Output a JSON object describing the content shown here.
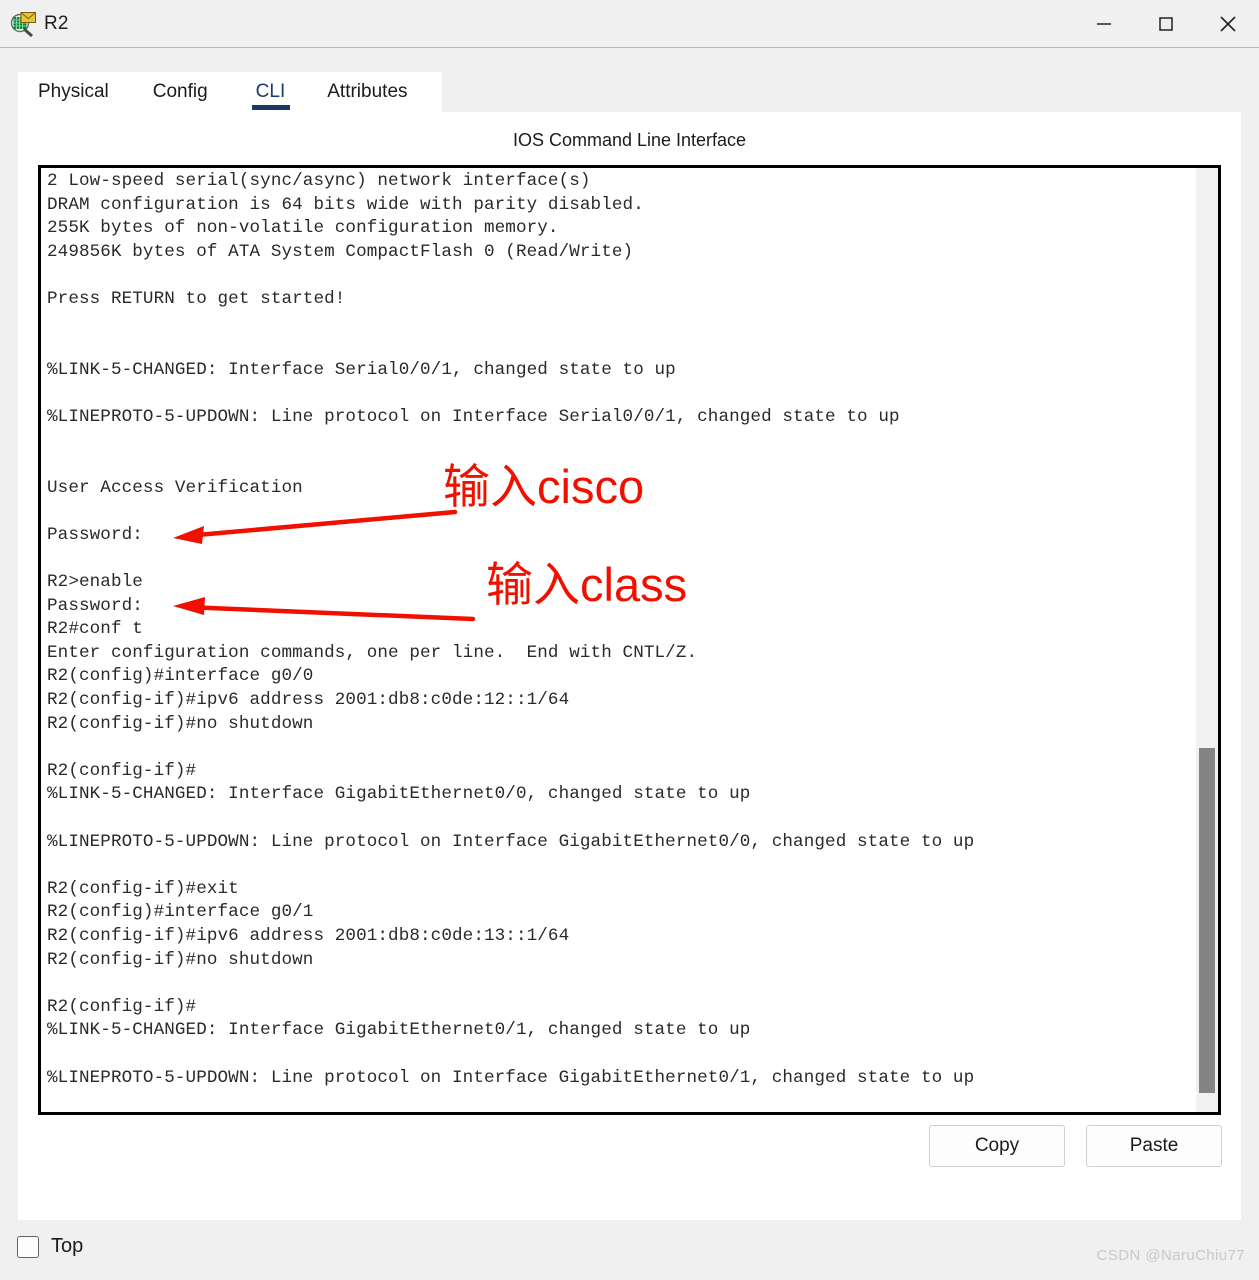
{
  "window": {
    "title": "R2",
    "icon": "inspect-magnifier-icon",
    "controls": {
      "minimize": "minimize-icon",
      "maximize": "maximize-icon",
      "close": "close-icon"
    }
  },
  "tabs": [
    {
      "label": "Physical",
      "active": false
    },
    {
      "label": "Config",
      "active": false
    },
    {
      "label": "CLI",
      "active": true
    },
    {
      "label": "Attributes",
      "active": false
    }
  ],
  "panel": {
    "title": "IOS Command Line Interface"
  },
  "terminal": {
    "lines": [
      "2 Low-speed serial(sync/async) network interface(s)",
      "DRAM configuration is 64 bits wide with parity disabled.",
      "255K bytes of non-volatile configuration memory.",
      "249856K bytes of ATA System CompactFlash 0 (Read/Write)",
      "",
      "Press RETURN to get started!",
      "",
      "",
      "%LINK-5-CHANGED: Interface Serial0/0/1, changed state to up",
      "",
      "%LINEPROTO-5-UPDOWN: Line protocol on Interface Serial0/0/1, changed state to up",
      "",
      "",
      "User Access Verification",
      "",
      "Password:",
      "",
      "R2>enable",
      "Password:",
      "R2#conf t",
      "Enter configuration commands, one per line.  End with CNTL/Z.",
      "R2(config)#interface g0/0",
      "R2(config-if)#ipv6 address 2001:db8:c0de:12::1/64",
      "R2(config-if)#no shutdown",
      "",
      "R2(config-if)#",
      "%LINK-5-CHANGED: Interface GigabitEthernet0/0, changed state to up",
      "",
      "%LINEPROTO-5-UPDOWN: Line protocol on Interface GigabitEthernet0/0, changed state to up",
      "",
      "R2(config-if)#exit",
      "R2(config)#interface g0/1",
      "R2(config-if)#ipv6 address 2001:db8:c0de:13::1/64",
      "R2(config-if)#no shutdown",
      "",
      "R2(config-if)#",
      "%LINK-5-CHANGED: Interface GigabitEthernet0/1, changed state to up",
      "",
      "%LINEPROTO-5-UPDOWN: Line protocol on Interface GigabitEthernet0/1, changed state to up"
    ]
  },
  "annotations": [
    {
      "text": "输入cisco",
      "color": "#f01000",
      "points_to": "Password:"
    },
    {
      "text": "输入class",
      "color": "#f01000",
      "points_to": "Password:"
    }
  ],
  "buttons": {
    "copy": "Copy",
    "paste": "Paste"
  },
  "bottom": {
    "top_checkbox_label": "Top",
    "top_checkbox_checked": false,
    "watermark": "CSDN @NaruChiu77"
  }
}
